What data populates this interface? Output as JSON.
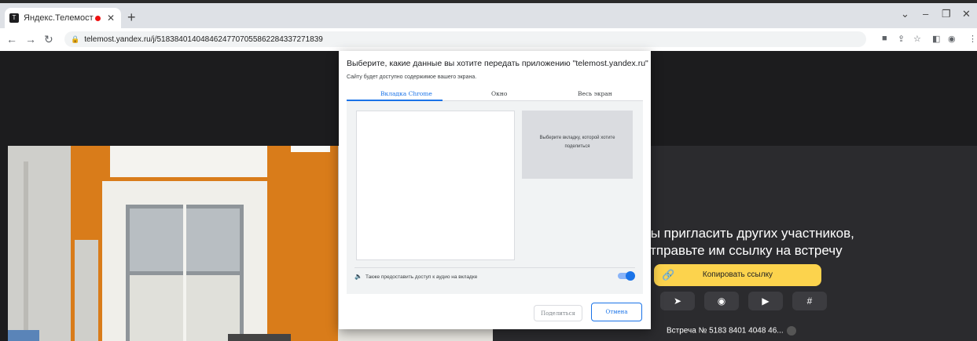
{
  "browser": {
    "tab_title": "Яндекс.Телемост",
    "tab_favicon": "Т",
    "url": "telemost.yandex.ru/j/51838401404846247707055862284337271839"
  },
  "dialog": {
    "title": "Выберите, какие данные вы хотите передать приложению \"telemost.yandex.ru\"",
    "subtitle": "Сайту будет доступно содержимое вашего экрана.",
    "tabs": [
      "Вкладка Chrome",
      "Окно",
      "Весь экран"
    ],
    "preview_text": "Выберите вкладку, которой хотите поделиться",
    "audio_label": "Также предоставить доступ к аудио на вкладке",
    "share_button": "Поделиться",
    "cancel_button": "Отмена"
  },
  "telemost": {
    "invite_line1": "бы пригласить других участников,",
    "invite_line2": "отправьте им ссылку на встречу",
    "copy_link": "Копировать ссылку",
    "meeting_id": "Встреча № 5183 8401 4048 46..."
  },
  "colors": {
    "accent": "#1a73e8",
    "copy_button": "#fcd34d",
    "dark_bg": "#1c1c1e"
  }
}
